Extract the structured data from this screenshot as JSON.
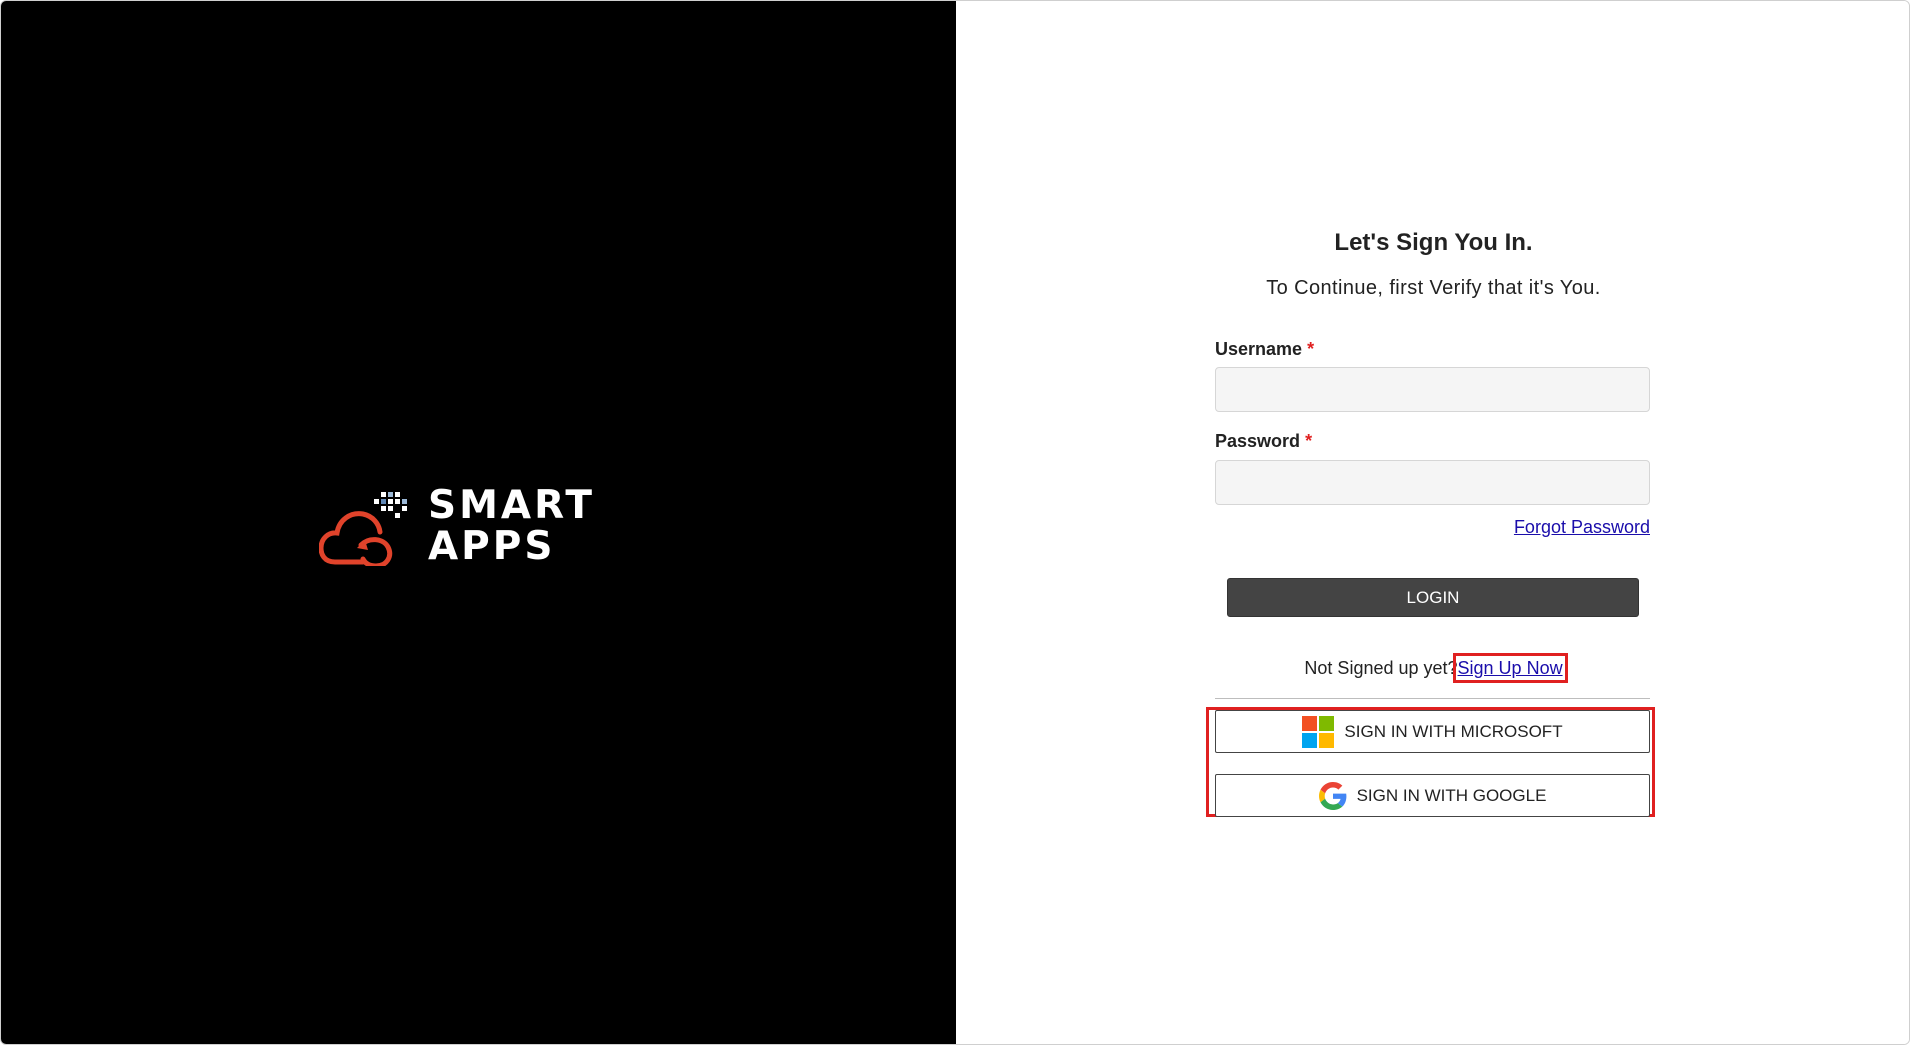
{
  "brand": {
    "line1": "SMART",
    "line2": "APPS",
    "logo_icon": "cloud-refresh-logo-icon",
    "accent_color": "#e0432b"
  },
  "login": {
    "title": "Let's Sign You In.",
    "subtitle": "To Continue, first Verify that it's You.",
    "username_label": "Username",
    "username_value": "",
    "password_label": "Password",
    "password_value": "",
    "required_mark": "*",
    "forgot_password": "Forgot Password",
    "login_button": "LOGIN",
    "signup_prompt": "Not Signed up yet?",
    "signup_link": "Sign Up Now",
    "microsoft_button": "SIGN IN WITH MICROSOFT",
    "google_button": "SIGN IN WITH GOOGLE"
  },
  "icons": {
    "microsoft": "microsoft-logo-icon",
    "google": "google-logo-icon"
  },
  "colors": {
    "left_panel": "#000000",
    "login_button": "#444444",
    "link": "#1a0dab",
    "highlight": "#e02020",
    "required": "#e02020",
    "microsoft": [
      "#f25022",
      "#7fba00",
      "#00a4ef",
      "#ffb900"
    ]
  }
}
